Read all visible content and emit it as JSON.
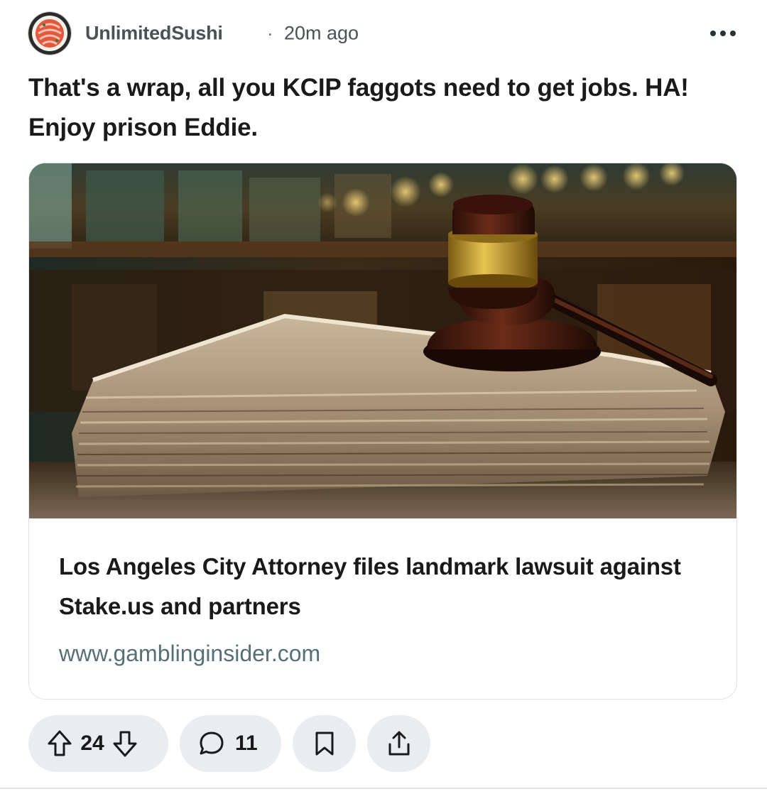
{
  "post": {
    "author": "UnlimitedSushi",
    "separator": "·",
    "time_ago": "20m ago",
    "title": "That's a wrap, all you KCIP faggots need to get jobs. HA! Enjoy prison Eddie."
  },
  "link_preview": {
    "headline": "Los Angeles City Attorney files landmark lawsuit against Stake.us and partners",
    "domain": "www.gamblinginsider.com"
  },
  "actions": {
    "score": "24",
    "comment_count": "11"
  },
  "icons": {
    "avatar": "sushi-avatar",
    "more": "more-options-icon",
    "upvote": "upvote-arrow-icon",
    "downvote": "downvote-arrow-icon",
    "comment": "comment-bubble-icon",
    "save": "bookmark-icon",
    "share": "share-icon"
  },
  "colors": {
    "text_primary": "#1a1a1b",
    "text_secondary": "#4b5254",
    "domain_text": "#576f76",
    "pill_bg": "#eaedef",
    "card_border": "#dfe3e6"
  }
}
